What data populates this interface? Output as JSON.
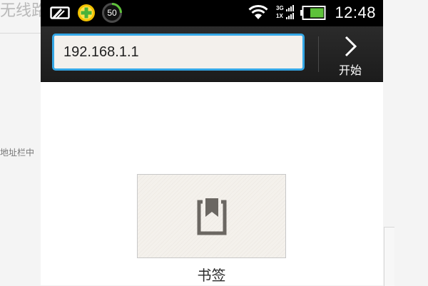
{
  "background": {
    "title": "无线路",
    "snippet": "地址栏中"
  },
  "status_bar": {
    "time": "12:48",
    "battery_badge": "50",
    "network_top": "3G",
    "network_bottom": "1X",
    "icons": [
      "cast-icon",
      "security-plus-icon",
      "battery-saver-50-icon",
      "wifi-icon",
      "signal-icon",
      "battery-icon"
    ]
  },
  "browser": {
    "url_value": "192.168.1.1",
    "go_label": "开始",
    "bookmarks_label": "书签"
  },
  "colors": {
    "url_border": "#34a7e6",
    "status_bar_bg": "#000000",
    "battery_green": "#5ec23a",
    "plus_yellow": "#f2c200",
    "plus_green": "#49b23a"
  }
}
